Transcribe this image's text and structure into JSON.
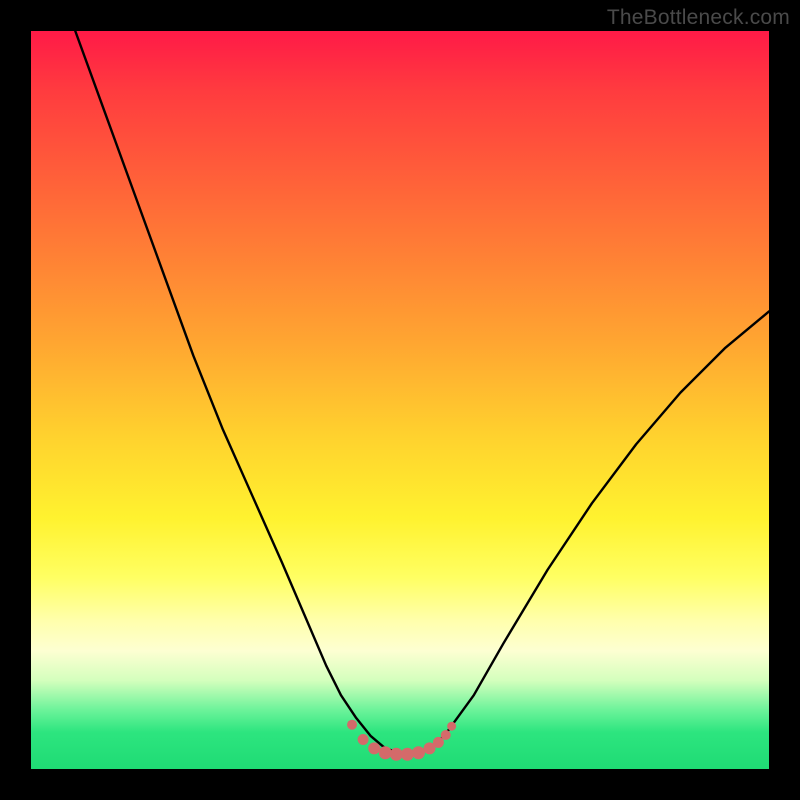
{
  "watermark": "TheBottleneck.com",
  "colors": {
    "frame": "#000000",
    "curve": "#000000",
    "marker_fill": "#d46a6a",
    "marker_stroke": "#c75a5a"
  },
  "chart_data": {
    "type": "line",
    "title": "",
    "xlabel": "",
    "ylabel": "",
    "xlim": [
      0,
      100
    ],
    "ylim": [
      0,
      100
    ],
    "grid": false,
    "legend": false,
    "series": [
      {
        "name": "bottleneck-curve",
        "x": [
          6,
          10,
          14,
          18,
          22,
          26,
          30,
          34,
          37,
          40,
          42,
          44,
          46,
          48,
          50,
          52,
          54,
          56,
          60,
          64,
          70,
          76,
          82,
          88,
          94,
          100
        ],
        "y": [
          100,
          89,
          78,
          67,
          56,
          46,
          37,
          28,
          21,
          14,
          10,
          7,
          4.5,
          2.8,
          2.2,
          2.2,
          2.8,
          4.5,
          10,
          17,
          27,
          36,
          44,
          51,
          57,
          62
        ]
      }
    ],
    "markers": {
      "name": "trough-markers",
      "x": [
        43.5,
        45,
        46.5,
        48,
        49.5,
        51,
        52.5,
        54,
        55.2,
        56.2,
        57
      ],
      "y": [
        6.0,
        4.0,
        2.8,
        2.2,
        2.0,
        2.0,
        2.2,
        2.8,
        3.6,
        4.6,
        5.8
      ],
      "r": [
        5,
        5.5,
        6,
        6.5,
        6.5,
        6.5,
        6.5,
        6,
        5.5,
        5,
        4.5
      ]
    }
  }
}
